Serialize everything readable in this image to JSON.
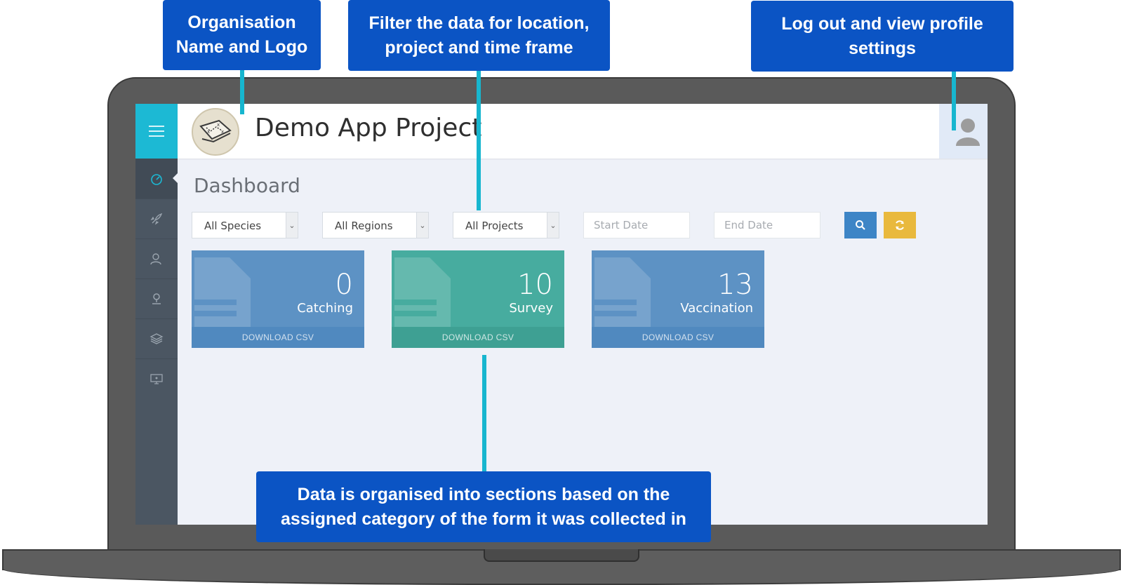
{
  "app": {
    "title": "Demo App Project"
  },
  "page": {
    "title": "Dashboard"
  },
  "filters": {
    "species": "All Species",
    "regions": "All Regions",
    "projects": "All Projects",
    "start_date_placeholder": "Start Date",
    "end_date_placeholder": "End Date"
  },
  "sidebar": {
    "icons": [
      "menu-icon",
      "dashboard-icon",
      "rocket-icon",
      "users-icon",
      "location-pin-icon",
      "layers-icon",
      "monitor-icon"
    ]
  },
  "tiles": [
    {
      "count": "0",
      "label": "Catching",
      "action": "DOWNLOAD CSV",
      "color": "#5d92c4"
    },
    {
      "count": "10",
      "label": "Survey",
      "action": "DOWNLOAD CSV",
      "color": "#47ac9f"
    },
    {
      "count": "13",
      "label": "Vaccination",
      "action": "DOWNLOAD CSV",
      "color": "#5d92c4"
    }
  ],
  "callouts": {
    "logo": "Organisation Name and Logo",
    "filter": "Filter the data for location, project and time frame",
    "profile": "Log out and view profile settings",
    "sections": "Data is organised into sections based on the assigned category of the form it was collected in"
  },
  "colors": {
    "accent": "#1cb9d4",
    "callout": "#0b54c4",
    "search_button": "#3d85c6",
    "refresh_button": "#e9b93d"
  }
}
